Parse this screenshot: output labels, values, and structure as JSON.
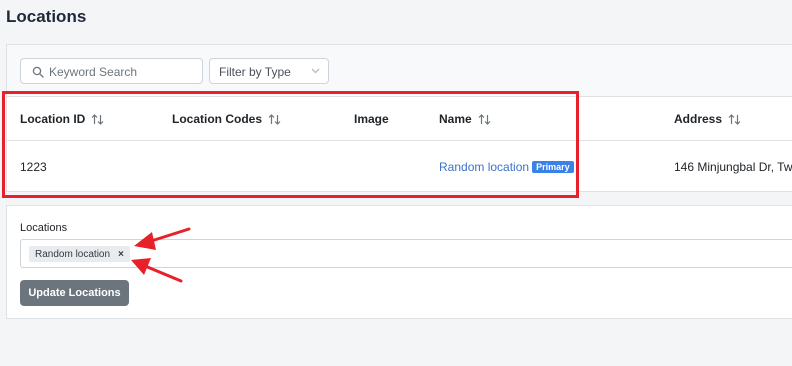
{
  "page": {
    "title": "Locations"
  },
  "filters": {
    "search_placeholder": "Keyword Search",
    "type_filter_label": "Filter by Type"
  },
  "table": {
    "columns": [
      "Location ID",
      "Location Codes",
      "Image",
      "Name",
      "Address"
    ],
    "rows": [
      {
        "location_id": "1223",
        "location_codes": "",
        "image": "",
        "name": "Random location",
        "name_badge": "Primary",
        "address": "146 Minjungbal Dr, Tw"
      }
    ]
  },
  "location_form": {
    "label": "Locations",
    "selected_tags": [
      {
        "label": "Random location",
        "remove_symbol": "×"
      }
    ],
    "update_button_label": "Update Locations"
  },
  "icons": {
    "search": "search-icon",
    "chevron": "chevron-down-icon",
    "sort": "sort-icon",
    "remove": "close-icon"
  },
  "colors": {
    "link": "#3b73c8",
    "badge": "#3b82e8",
    "annotation": "#e8202a",
    "button": "#6c757d"
  }
}
